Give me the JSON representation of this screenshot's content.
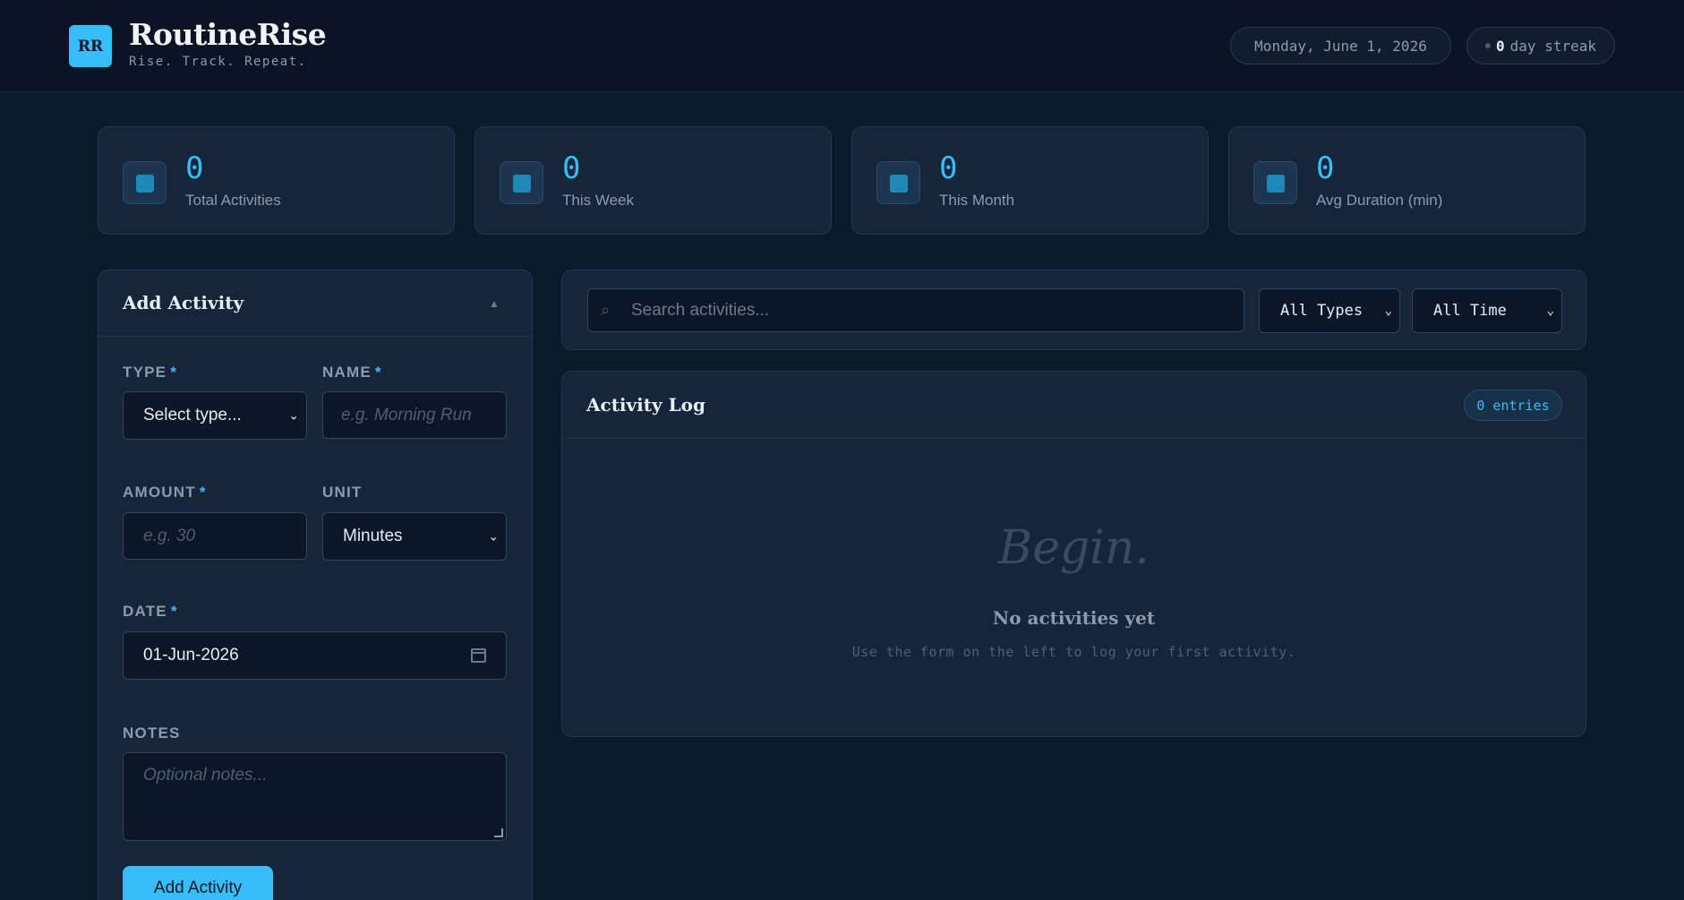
{
  "header": {
    "logo_initials": "RR",
    "title": "RoutineRise",
    "tagline": "Rise. Track. Repeat.",
    "date": "Monday, June 1, 2026",
    "streak_count": "0",
    "streak_label": "day streak"
  },
  "stats": [
    {
      "value": "0",
      "label": "Total Activities"
    },
    {
      "value": "0",
      "label": "This Week"
    },
    {
      "value": "0",
      "label": "This Month"
    },
    {
      "value": "0",
      "label": "Avg Duration (min)"
    }
  ],
  "form": {
    "title": "Add Activity",
    "collapse_glyph": "▲",
    "type_label": "TYPE",
    "type_value": "Select type...",
    "name_label": "NAME",
    "name_placeholder": "e.g. Morning Run",
    "amount_label": "AMOUNT",
    "amount_placeholder": "e.g. 30",
    "unit_label": "UNIT",
    "unit_value": "Minutes",
    "date_label": "DATE",
    "date_value": "01-Jun-2026",
    "notes_label": "NOTES",
    "notes_placeholder": "Optional notes...",
    "required_mark": "*",
    "submit_label": "Add Activity"
  },
  "search": {
    "icon_glyph": "⌕",
    "placeholder": "Search activities...",
    "type_filter": "All Types",
    "time_filter": "All Time"
  },
  "log": {
    "title": "Activity Log",
    "entries_badge": "0 entries",
    "empty_big": "Begin.",
    "empty_title": "No activities yet",
    "empty_subtitle": "Use the form on the left to log your first activity."
  },
  "colors": {
    "accent": "#38bdf8",
    "background": "#0d1a2b",
    "panel": "#17253a"
  },
  "icons": {
    "stat_icon": "square-icon",
    "search": "search-icon",
    "calendar": "calendar-icon",
    "chevron": "chevron-down-icon",
    "collapse": "chevron-up-icon"
  }
}
